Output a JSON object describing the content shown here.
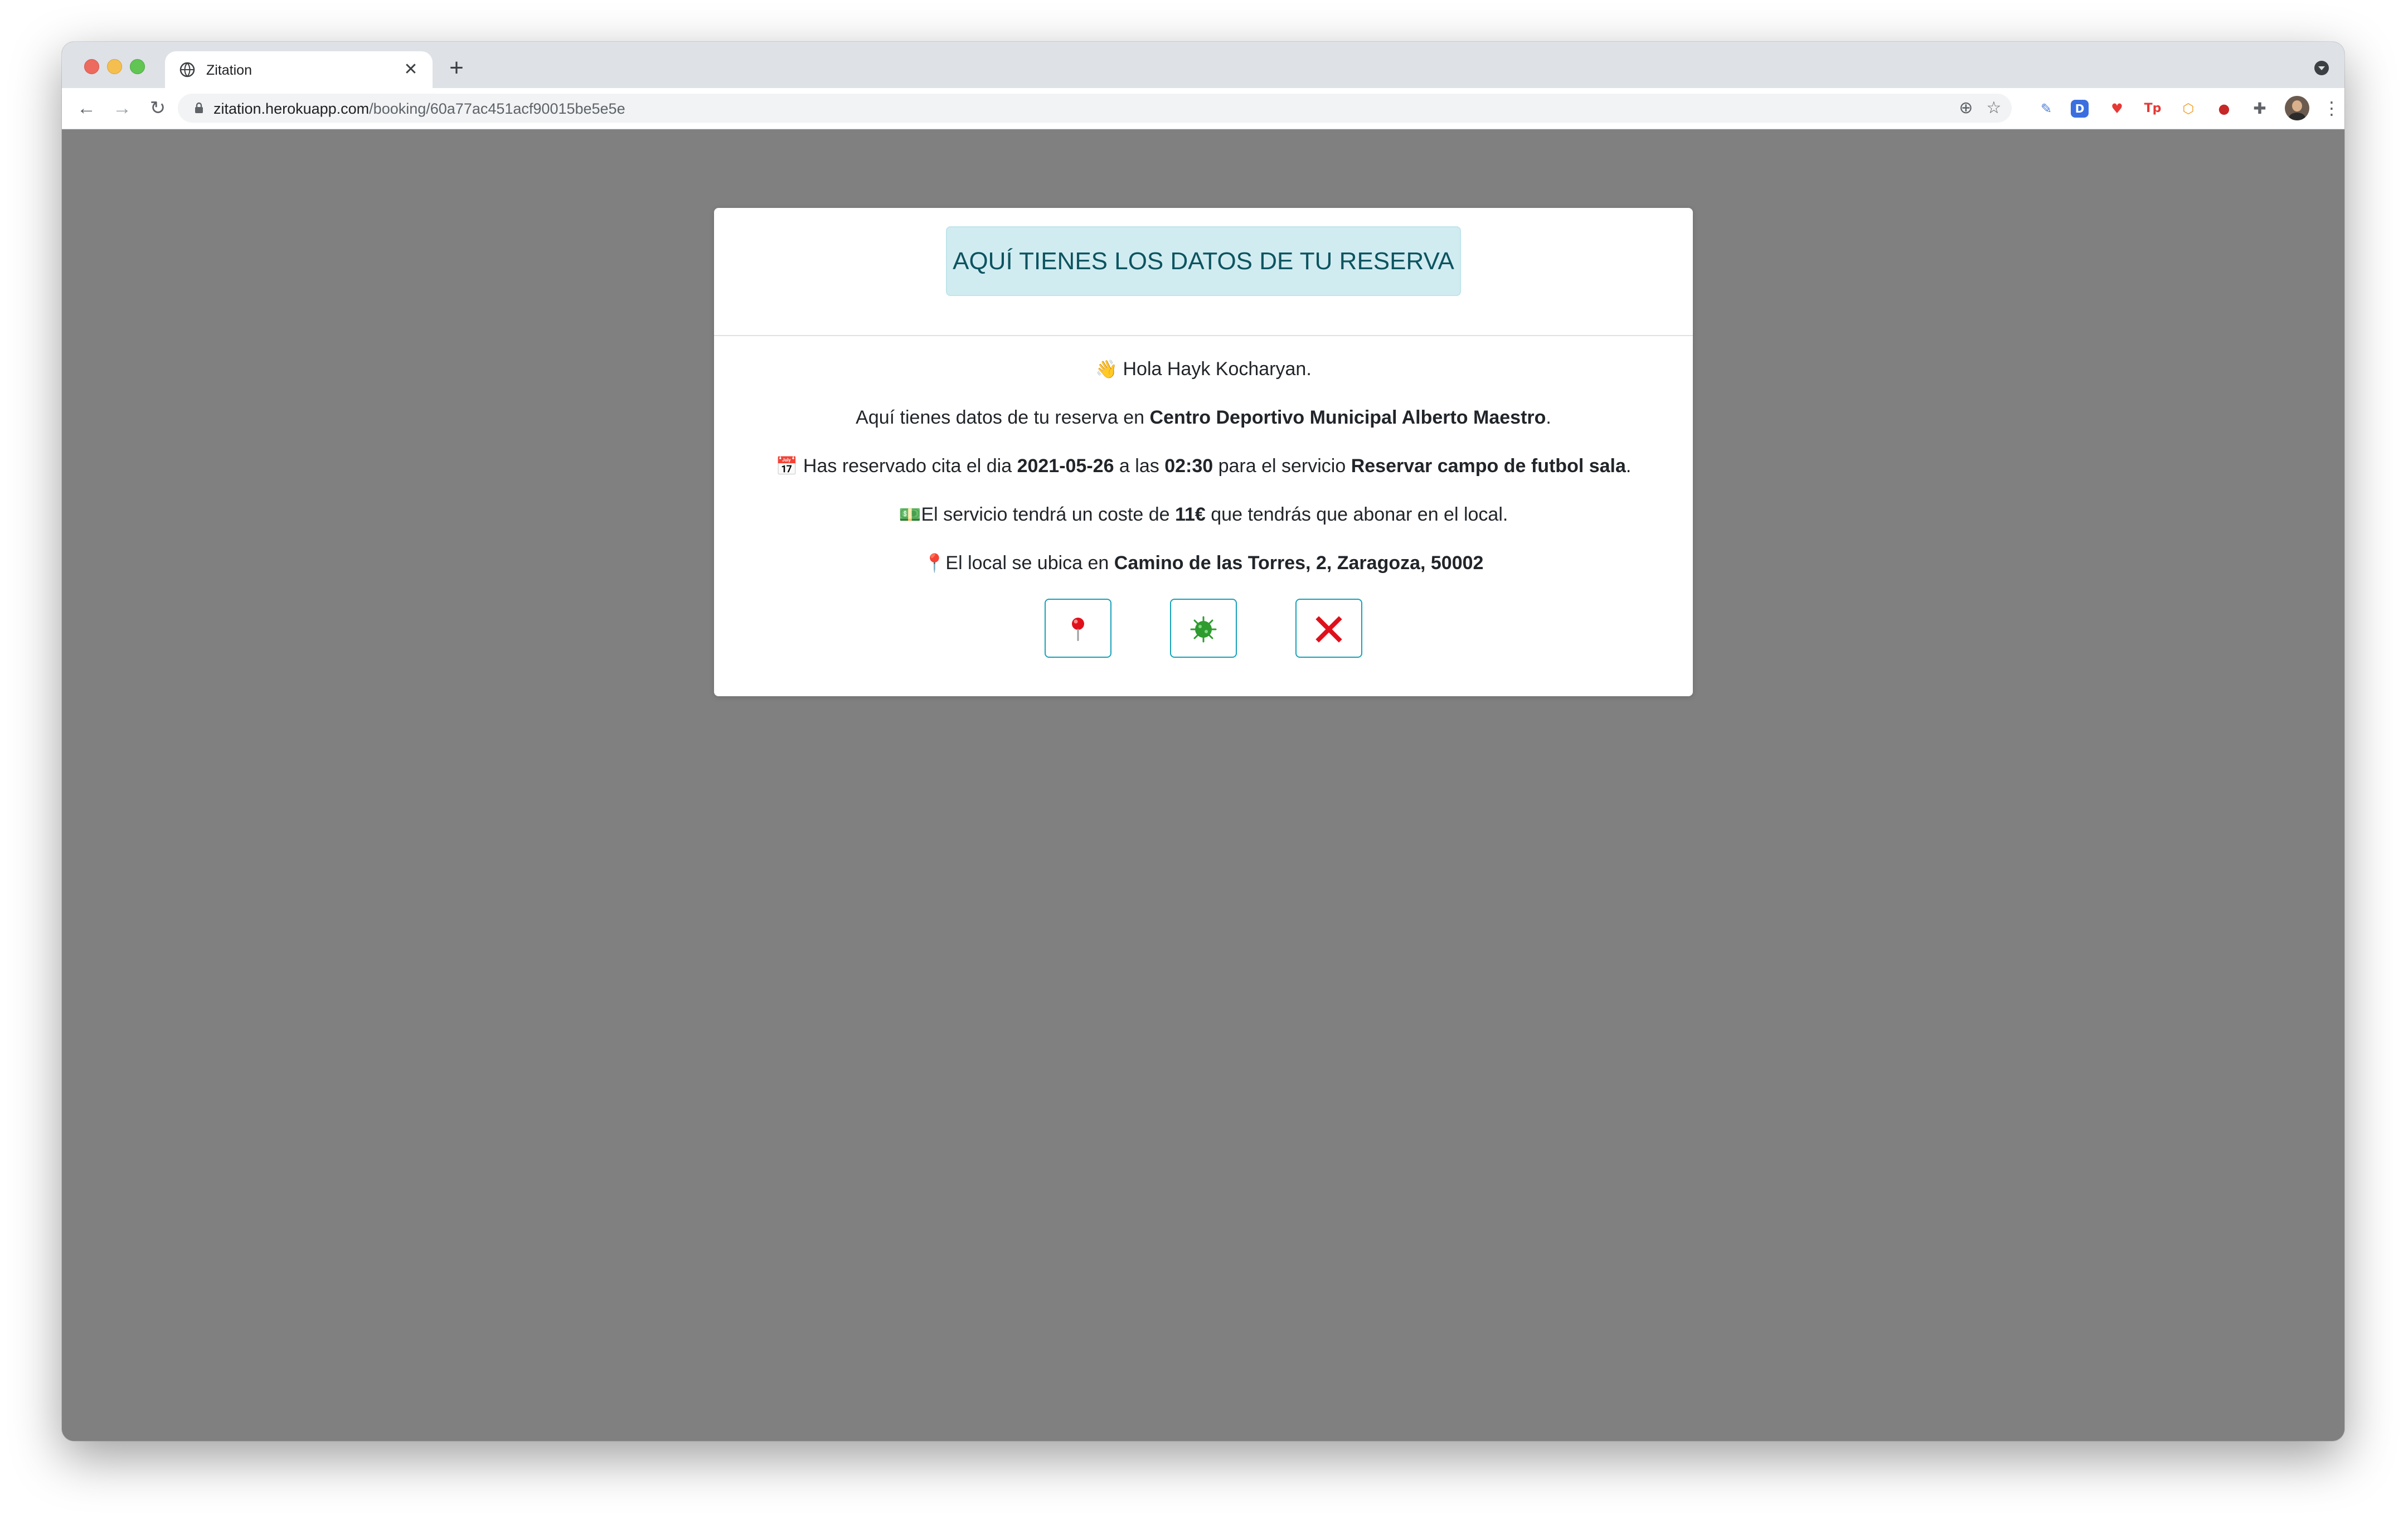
{
  "browser": {
    "tab_title": "Zitation",
    "tab_close": "✕",
    "new_tab": "+",
    "url_host": "zitation.herokuapp.com",
    "url_path": "/booking/60a77ac451acf90015be5e5e",
    "nav": {
      "back": "←",
      "forward": "→",
      "reload": "↻"
    },
    "icons": {
      "zoom": "⊕",
      "bookmark": "☆",
      "puzzle": "✚",
      "menu": "⋮"
    },
    "extensions": [
      {
        "name": "feather-extension-icon",
        "glyph": "✎",
        "color": "#4a7fd6"
      },
      {
        "name": "d-extension-icon",
        "glyph": "D",
        "color": "#3b6fe0"
      },
      {
        "name": "shield-extension-icon",
        "glyph": "♥",
        "color": "#e53935"
      },
      {
        "name": "tp-extension-icon",
        "glyph": "Tp",
        "color": "#e53935"
      },
      {
        "name": "hex-extension-icon",
        "glyph": "⬡",
        "color": "#f29b1d"
      },
      {
        "name": "red-circle-extension-icon",
        "glyph": "●",
        "color": "#c62828"
      }
    ]
  },
  "modal": {
    "header_title": "AQUÍ TIENES LOS DATOS DE TU RESERVA",
    "greeting": {
      "icon": "👋",
      "text": "Hola Hayk Kocharyan."
    },
    "center_line": {
      "prefix": "Aquí tienes datos de tu reserva en ",
      "center_name": "Centro Deportivo Municipal Alberto Maestro",
      "suffix": "."
    },
    "date_line": {
      "icon": "📅",
      "prefix": "Has reservado cita el dia ",
      "date": "2021-05-26",
      "mid1": " a las ",
      "time": "02:30",
      "mid2": " para el servicio ",
      "service": "Reservar campo de futbol sala",
      "suffix": "."
    },
    "price_line": {
      "icon": "💵",
      "prefix": "El servicio tendrá un coste de ",
      "price": "11€",
      "suffix": " que tendrás que abonar en el local."
    },
    "location_line": {
      "icon": "📍",
      "prefix": "El local se ubica en ",
      "address": "Camino de las Torres, 2, Zaragoza, 50002"
    },
    "buttons": [
      {
        "name": "map-pin-button",
        "icon": "map-pin-icon"
      },
      {
        "name": "covid-info-button",
        "icon": "virus-icon"
      },
      {
        "name": "cancel-booking-button",
        "icon": "red-x-icon"
      }
    ]
  },
  "colors": {
    "alert_bg": "#d1ecf1",
    "alert_text": "#0c5460",
    "button_border": "#17a2b8",
    "overlay": "#808080",
    "cancel_red": "#e0101b",
    "virus_green": "#2e9b2e"
  }
}
